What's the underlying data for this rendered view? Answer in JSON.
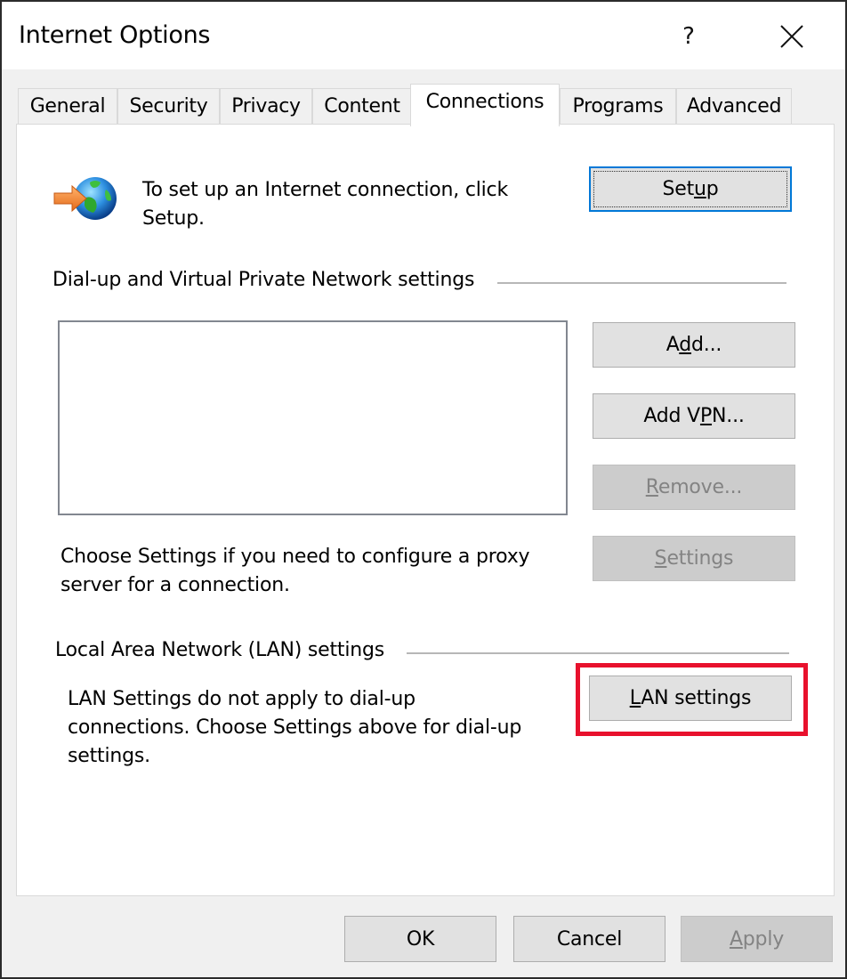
{
  "window": {
    "title": "Internet Options",
    "help_label": "?",
    "close_icon": "close-icon"
  },
  "tabs": [
    {
      "label": "General",
      "active": false
    },
    {
      "label": "Security",
      "active": false
    },
    {
      "label": "Privacy",
      "active": false
    },
    {
      "label": "Content",
      "active": false
    },
    {
      "label": "Connections",
      "active": true
    },
    {
      "label": "Programs",
      "active": false
    },
    {
      "label": "Advanced",
      "active": false
    }
  ],
  "connections": {
    "setup": {
      "icon": "globe-arrow-icon",
      "description_line1": "To set up an Internet connection, click",
      "description_line2": "Setup.",
      "button": {
        "pre": "Set",
        "accel": "u",
        "post": "p",
        "label": "Setup",
        "enabled": true,
        "default": true
      }
    },
    "dialup": {
      "group_label": "Dial-up and Virtual Private Network settings",
      "list_items": [],
      "buttons": {
        "add": {
          "pre": "A",
          "accel": "d",
          "post": "d...",
          "label": "Add...",
          "enabled": true
        },
        "add_vpn": {
          "pre": "Add V",
          "accel": "P",
          "post": "N...",
          "label": "Add VPN...",
          "enabled": true
        },
        "remove": {
          "pre": "",
          "accel": "R",
          "post": "emove...",
          "label": "Remove...",
          "enabled": false
        },
        "settings": {
          "pre": "",
          "accel": "S",
          "post": "ettings",
          "label": "Settings",
          "enabled": false
        }
      },
      "proxy_text_line1": "Choose Settings if you need to configure a proxy",
      "proxy_text_line2": "server for a connection."
    },
    "lan": {
      "group_label": "Local Area Network (LAN) settings",
      "text_line1": "LAN Settings do not apply to dial-up",
      "text_line2": "connections. Choose Settings above for dial-up",
      "text_line3": "settings.",
      "button": {
        "pre": "",
        "accel": "L",
        "post": "AN settings",
        "label": "LAN settings",
        "enabled": true
      },
      "highlight_color": "#e8112d"
    }
  },
  "footer": {
    "ok": {
      "label": "OK",
      "enabled": true
    },
    "cancel": {
      "label": "Cancel",
      "enabled": true
    },
    "apply": {
      "pre": "",
      "accel": "A",
      "post": "pply",
      "label": "Apply",
      "enabled": false
    }
  },
  "colors": {
    "focus_border": "#0078d7",
    "highlight": "#e8112d",
    "disabled_text": "#838383"
  }
}
